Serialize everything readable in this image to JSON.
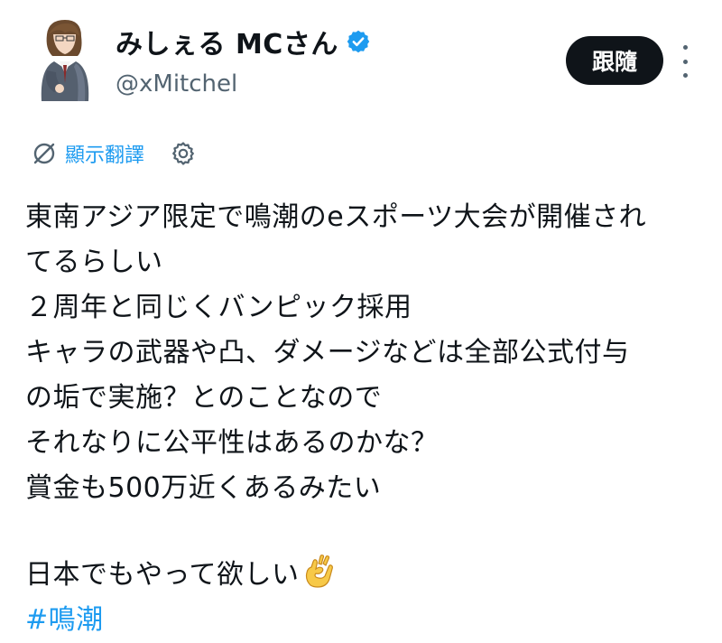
{
  "author": {
    "display_name": "みしぇる MCさん",
    "handle": "@xMitchel",
    "verified": true,
    "verified_color": "#1d9bf0"
  },
  "actions": {
    "follow_label": "跟隨"
  },
  "translate": {
    "label": "顯示翻譯"
  },
  "tweet": {
    "lines": [
      "東南アジア限定で鳴潮のeスポーツ大会が開催され",
      "てるらしい",
      "２周年と同じくバンピック採用",
      "キャラの武器や凸、ダメージなどは全部公式付与",
      "の垢で実施？とのことなので",
      "それなりに公平性はあるのかな？",
      "賞金も500万近くあるみたい"
    ],
    "closing_text": "日本でもやって欲しい",
    "closing_emoji": "ok-hand-emoji",
    "hashtag": "#鳴潮"
  },
  "colors": {
    "text": "#0f1419",
    "secondary": "#536471",
    "accent": "#1d9bf0",
    "button": "#0f1419"
  }
}
